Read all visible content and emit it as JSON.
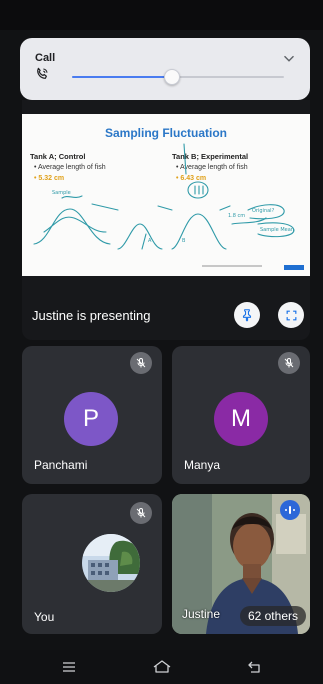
{
  "call_panel": {
    "title": "Call",
    "volume_level": 0.47,
    "icons": {
      "phone": "phone-volume-icon",
      "collapse": "chevron-down-icon"
    }
  },
  "presentation": {
    "slide": {
      "title": "Sampling Fluctuation",
      "tank_a": {
        "heading": "Tank A; Control",
        "item": "Average length of fish",
        "value": "5.32 cm"
      },
      "tank_b": {
        "heading": "Tank B; Experimental",
        "item": "Average length of fish",
        "value": "6.43 cm"
      }
    },
    "presenting_label": "Justine is presenting",
    "icons": {
      "pin": "pin-icon",
      "fullscreen": "fullscreen-icon"
    }
  },
  "participants": [
    {
      "name": "Panchami",
      "initial": "P",
      "avatar_color": "#7d57c7",
      "muted": true
    },
    {
      "name": "Manya",
      "initial": "M",
      "avatar_color": "#8a2aa5",
      "muted": true
    },
    {
      "name": "You",
      "muted": true
    },
    {
      "name": "Justine",
      "others_label": "62 others"
    }
  ],
  "nav": {
    "icons": [
      "recent-apps-icon",
      "home-icon",
      "back-icon"
    ]
  },
  "colors": {
    "accent": "#4a7cf0",
    "tile_bg": "#2d2f34",
    "background": "#111214"
  }
}
